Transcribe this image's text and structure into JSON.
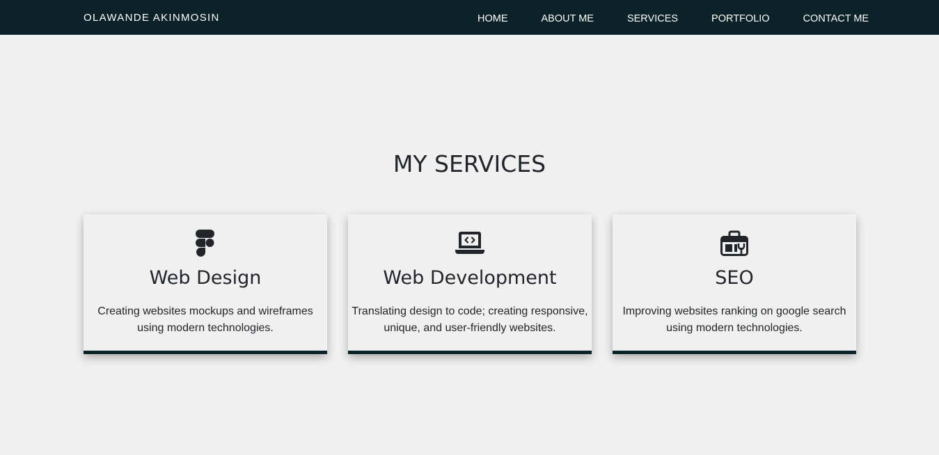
{
  "brand": "OLAWANDE AKINMOSIN",
  "nav": {
    "items": [
      {
        "label": "HOME"
      },
      {
        "label": "ABOUT ME"
      },
      {
        "label": "SERVICES"
      },
      {
        "label": "PORTFOLIO"
      },
      {
        "label": "CONTACT ME"
      }
    ]
  },
  "services": {
    "title": "MY SERVICES",
    "cards": [
      {
        "icon": "figma-icon",
        "title": "Web Design",
        "text_lines": [
          "Creating websites mockups and wireframes",
          "using modern technologies."
        ]
      },
      {
        "icon": "laptop-code-icon",
        "title": "Web Development",
        "text_lines": [
          "Translating design to code; creating responsive,",
          "unique, and user-friendly websites."
        ]
      },
      {
        "icon": "toolbox-icon",
        "title": "SEO",
        "text_lines": [
          "Improving websites ranking on google search",
          "using modern technologies."
        ]
      }
    ]
  },
  "colors": {
    "navbar_bg": "#0b2228",
    "page_bg": "#f0f0f0",
    "text": "#212529",
    "accent": "#0b2228"
  }
}
